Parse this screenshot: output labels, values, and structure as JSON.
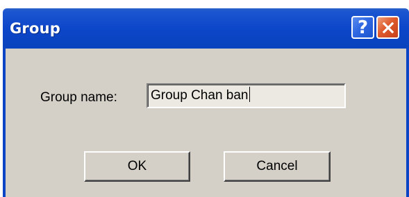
{
  "window": {
    "title": "Group",
    "help_glyph": "?",
    "close_icon": "close-icon"
  },
  "form": {
    "label": "Group name:",
    "value": "Group Chan ban"
  },
  "buttons": {
    "ok": "OK",
    "cancel": "Cancel"
  },
  "colors": {
    "titlebar": "#0b45c5",
    "dialog_bg": "#d4d0c8",
    "close_button": "#de5a2c",
    "help_button": "#2f68e2"
  }
}
